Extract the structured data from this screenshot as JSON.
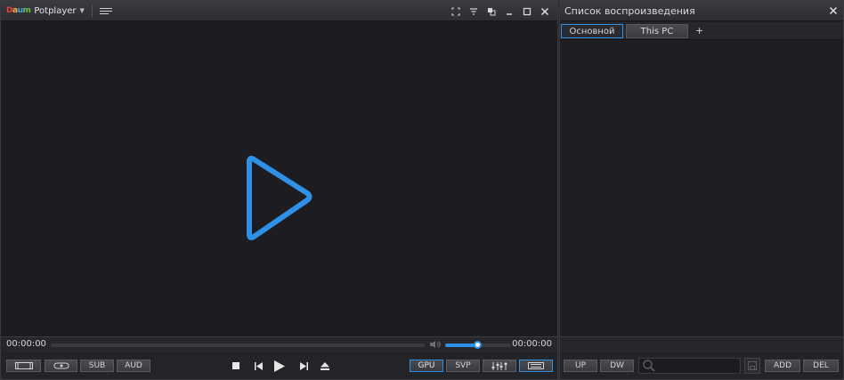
{
  "player": {
    "app_name": "Potplayer",
    "logo_letters": [
      "D",
      "a",
      "u",
      "m"
    ],
    "time_elapsed": "00:00:00",
    "time_total": "00:00:00",
    "volume_fraction": 0.5,
    "buttons": {
      "sub": "SUB",
      "aud": "AUD",
      "gpu": "GPU",
      "svp": "SVP"
    },
    "accent_color": "#2f90e8"
  },
  "playlist": {
    "title": "Список воспроизведения",
    "tabs": [
      {
        "label": "Основной",
        "active": true
      },
      {
        "label": "This PC",
        "active": false
      }
    ],
    "add_tab": "+",
    "buttons": {
      "up": "UP",
      "dw": "DW",
      "add": "ADD",
      "del": "DEL"
    }
  }
}
